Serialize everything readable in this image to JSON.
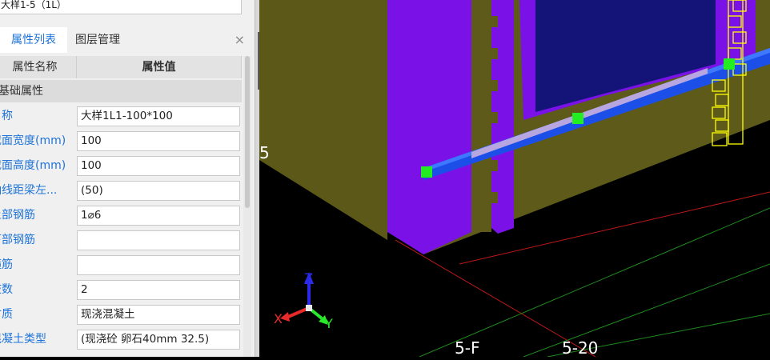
{
  "top_field_text": "大样1-5（1L）",
  "tabs": [
    {
      "label": "属性列表",
      "active": true
    },
    {
      "label": "图层管理",
      "active": false
    }
  ],
  "close_glyph": "×",
  "table_header": {
    "name": "属性名称",
    "value": "属性值"
  },
  "group_label": "基础属性",
  "rows": [
    {
      "name": "名称",
      "value": "大样1L1-100*100"
    },
    {
      "name": "截面宽度(mm)",
      "value": "100"
    },
    {
      "name": "截面高度(mm)",
      "value": "100"
    },
    {
      "name": "轴线距梁左...",
      "value": "(50)"
    },
    {
      "name": "上部钢筋",
      "value": "1⌀6"
    },
    {
      "name": "下部钢筋",
      "value": ""
    },
    {
      "name": "箍筋",
      "value": ""
    },
    {
      "name": "肢数",
      "value": "2"
    },
    {
      "name": "材质",
      "value": "现浇混凝土"
    },
    {
      "name": "混凝土类型",
      "value": "(现浇砼 卵石40mm 32.5)"
    }
  ],
  "collapse_glyph": "‹",
  "viewport": {
    "grid_label_left": "5",
    "grid_label_bottom_1": "5-F",
    "grid_label_bottom_2": "5-20",
    "axis_x": "X",
    "axis_y": "Y",
    "axis_z": "Z"
  },
  "colors": {
    "accent_blue": "#1e73d8",
    "wall_purple": "#7a12e8",
    "wall_olive": "#5e5a1a",
    "opening_navy": "#141478",
    "beam_blue": "#1c4fe8",
    "grip_green": "#22ee22",
    "selection_yellow": "#ffff00"
  }
}
